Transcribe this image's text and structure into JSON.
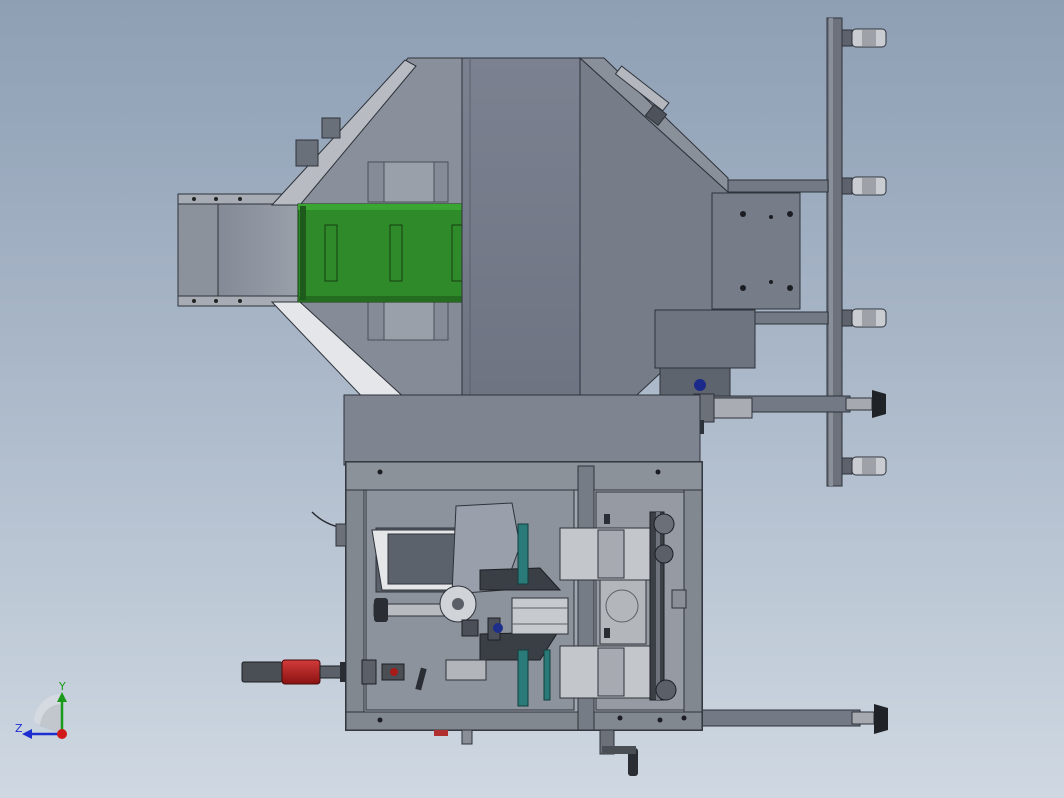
{
  "triad": {
    "y_label": "Y",
    "z_label": "Z",
    "y_color": "#1a9a1a",
    "z_color": "#1d2fd0",
    "x_color": "#d01a1a"
  },
  "colors": {
    "frame": "#6b7280",
    "hopper": "#777d8a",
    "hopper_dark": "#5f6572",
    "conveyor": "#2f8a2a",
    "handle_red": "#a81b1b"
  }
}
